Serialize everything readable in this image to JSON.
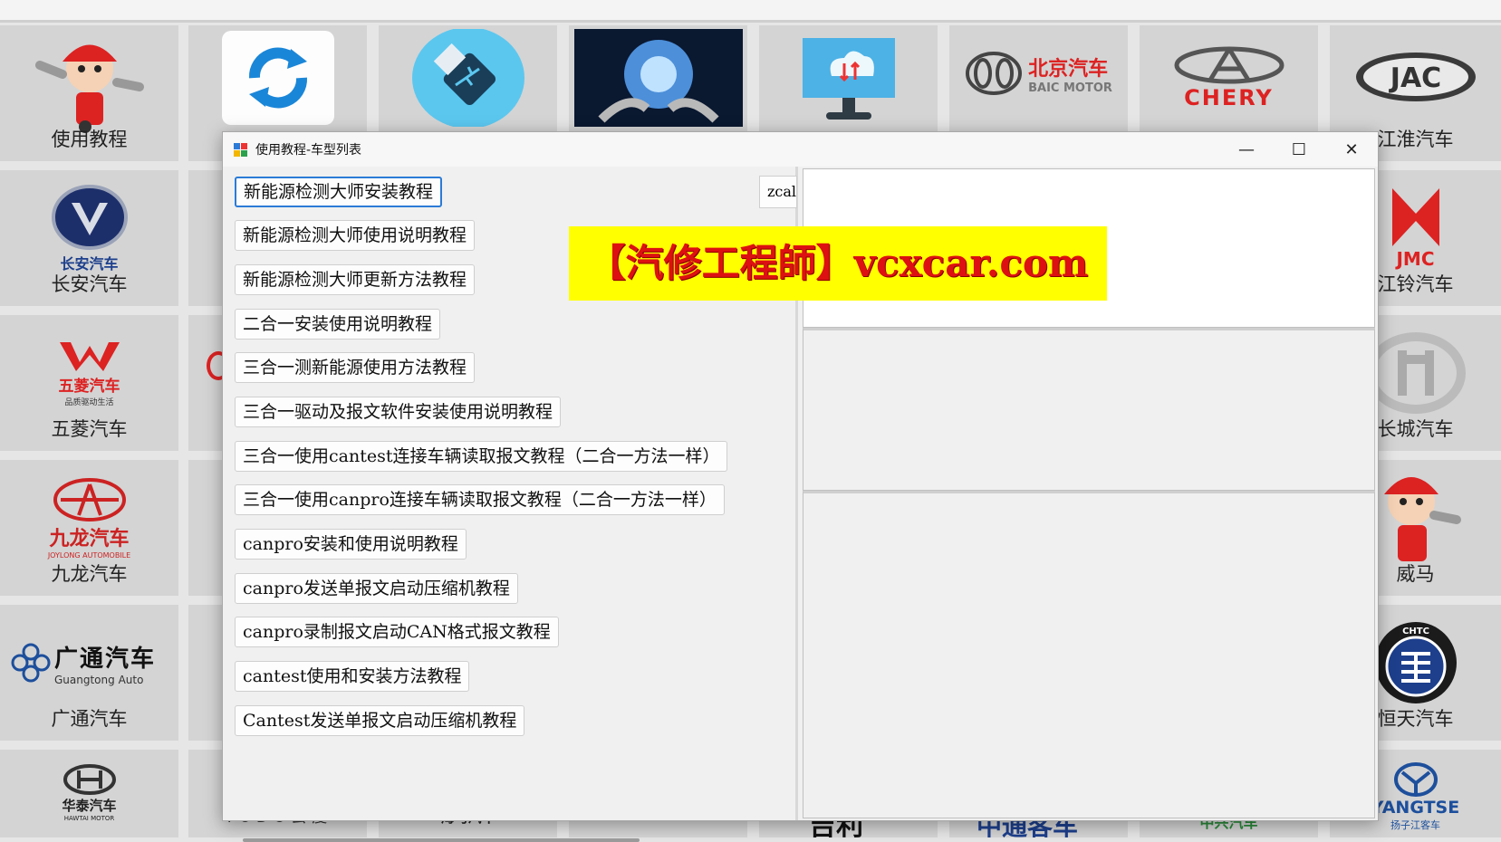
{
  "tiles": {
    "tutorial": "使用教程",
    "changan": "长安汽车",
    "changan_brand": "长安汽车",
    "wuling": "五菱汽车",
    "wuling_brand": "五菱汽车",
    "wuling_slogan": "品质驱动生活",
    "jiulong": "九龙汽车",
    "jiulong_brand": "九龙汽车",
    "jiulong_sub": "JOYLONG AUTOMOBILE",
    "guangtong": "广通汽车",
    "guangtong_brand": "广通汽车",
    "guangtong_sub": "Guangtong Auto",
    "hawtai_brand": "华泰汽车",
    "hawtai_sub": "HAWTAI MOTOR",
    "yudo_brand": "YUDO云度",
    "haima_brand": "海马汽车",
    "baic_cn": "北京汽车",
    "baic_en": "BAIC MOTOR",
    "chery": "CHERY",
    "jac": "江淮汽车",
    "jac_logo": "JAC",
    "jmc": "江铃汽车",
    "jmc_logo": "JMC",
    "greatwall": "长城汽车",
    "weima": "威马",
    "hengtian": "恒天汽车",
    "hengtian_ring": "CHTC",
    "yangtse_logo": "YANGTSE",
    "yangtse_cn": "扬子江客车",
    "zhongxing": "中兴汽车",
    "jili_partial": "吉利",
    "zhongtong_partial": "中通客车"
  },
  "dialog": {
    "title": "使用教程-车型列表",
    "minimize": "—",
    "maximize": "☐",
    "close": "✕",
    "search_value": "zcal",
    "buttons": [
      "新能源检测大师安装教程",
      "新能源检测大师使用说明教程",
      "新能源检测大师更新方法教程",
      "二合一安装使用说明教程",
      "三合一测新能源使用方法教程",
      "三合一驱动及报文软件安装使用说明教程",
      "三合一使用cantest连接车辆读取报文教程（二合一方法一样）",
      "三合一使用canpro连接车辆读取报文教程（二合一方法一样）",
      "canpro安装和使用说明教程",
      "canpro发送单报文启动压缩机教程",
      "canpro录制报文启动CAN格式报文教程",
      "cantest使用和安装方法教程",
      "Cantest发送单报文启动压缩机教程"
    ]
  },
  "watermark": "【汽修工程師】vcxcar.com",
  "colors": {
    "accent": "#2b7bd6",
    "watermark_bg": "#ffff00",
    "watermark_text": "#d11111",
    "tile_bg": "#d4d4d4"
  }
}
